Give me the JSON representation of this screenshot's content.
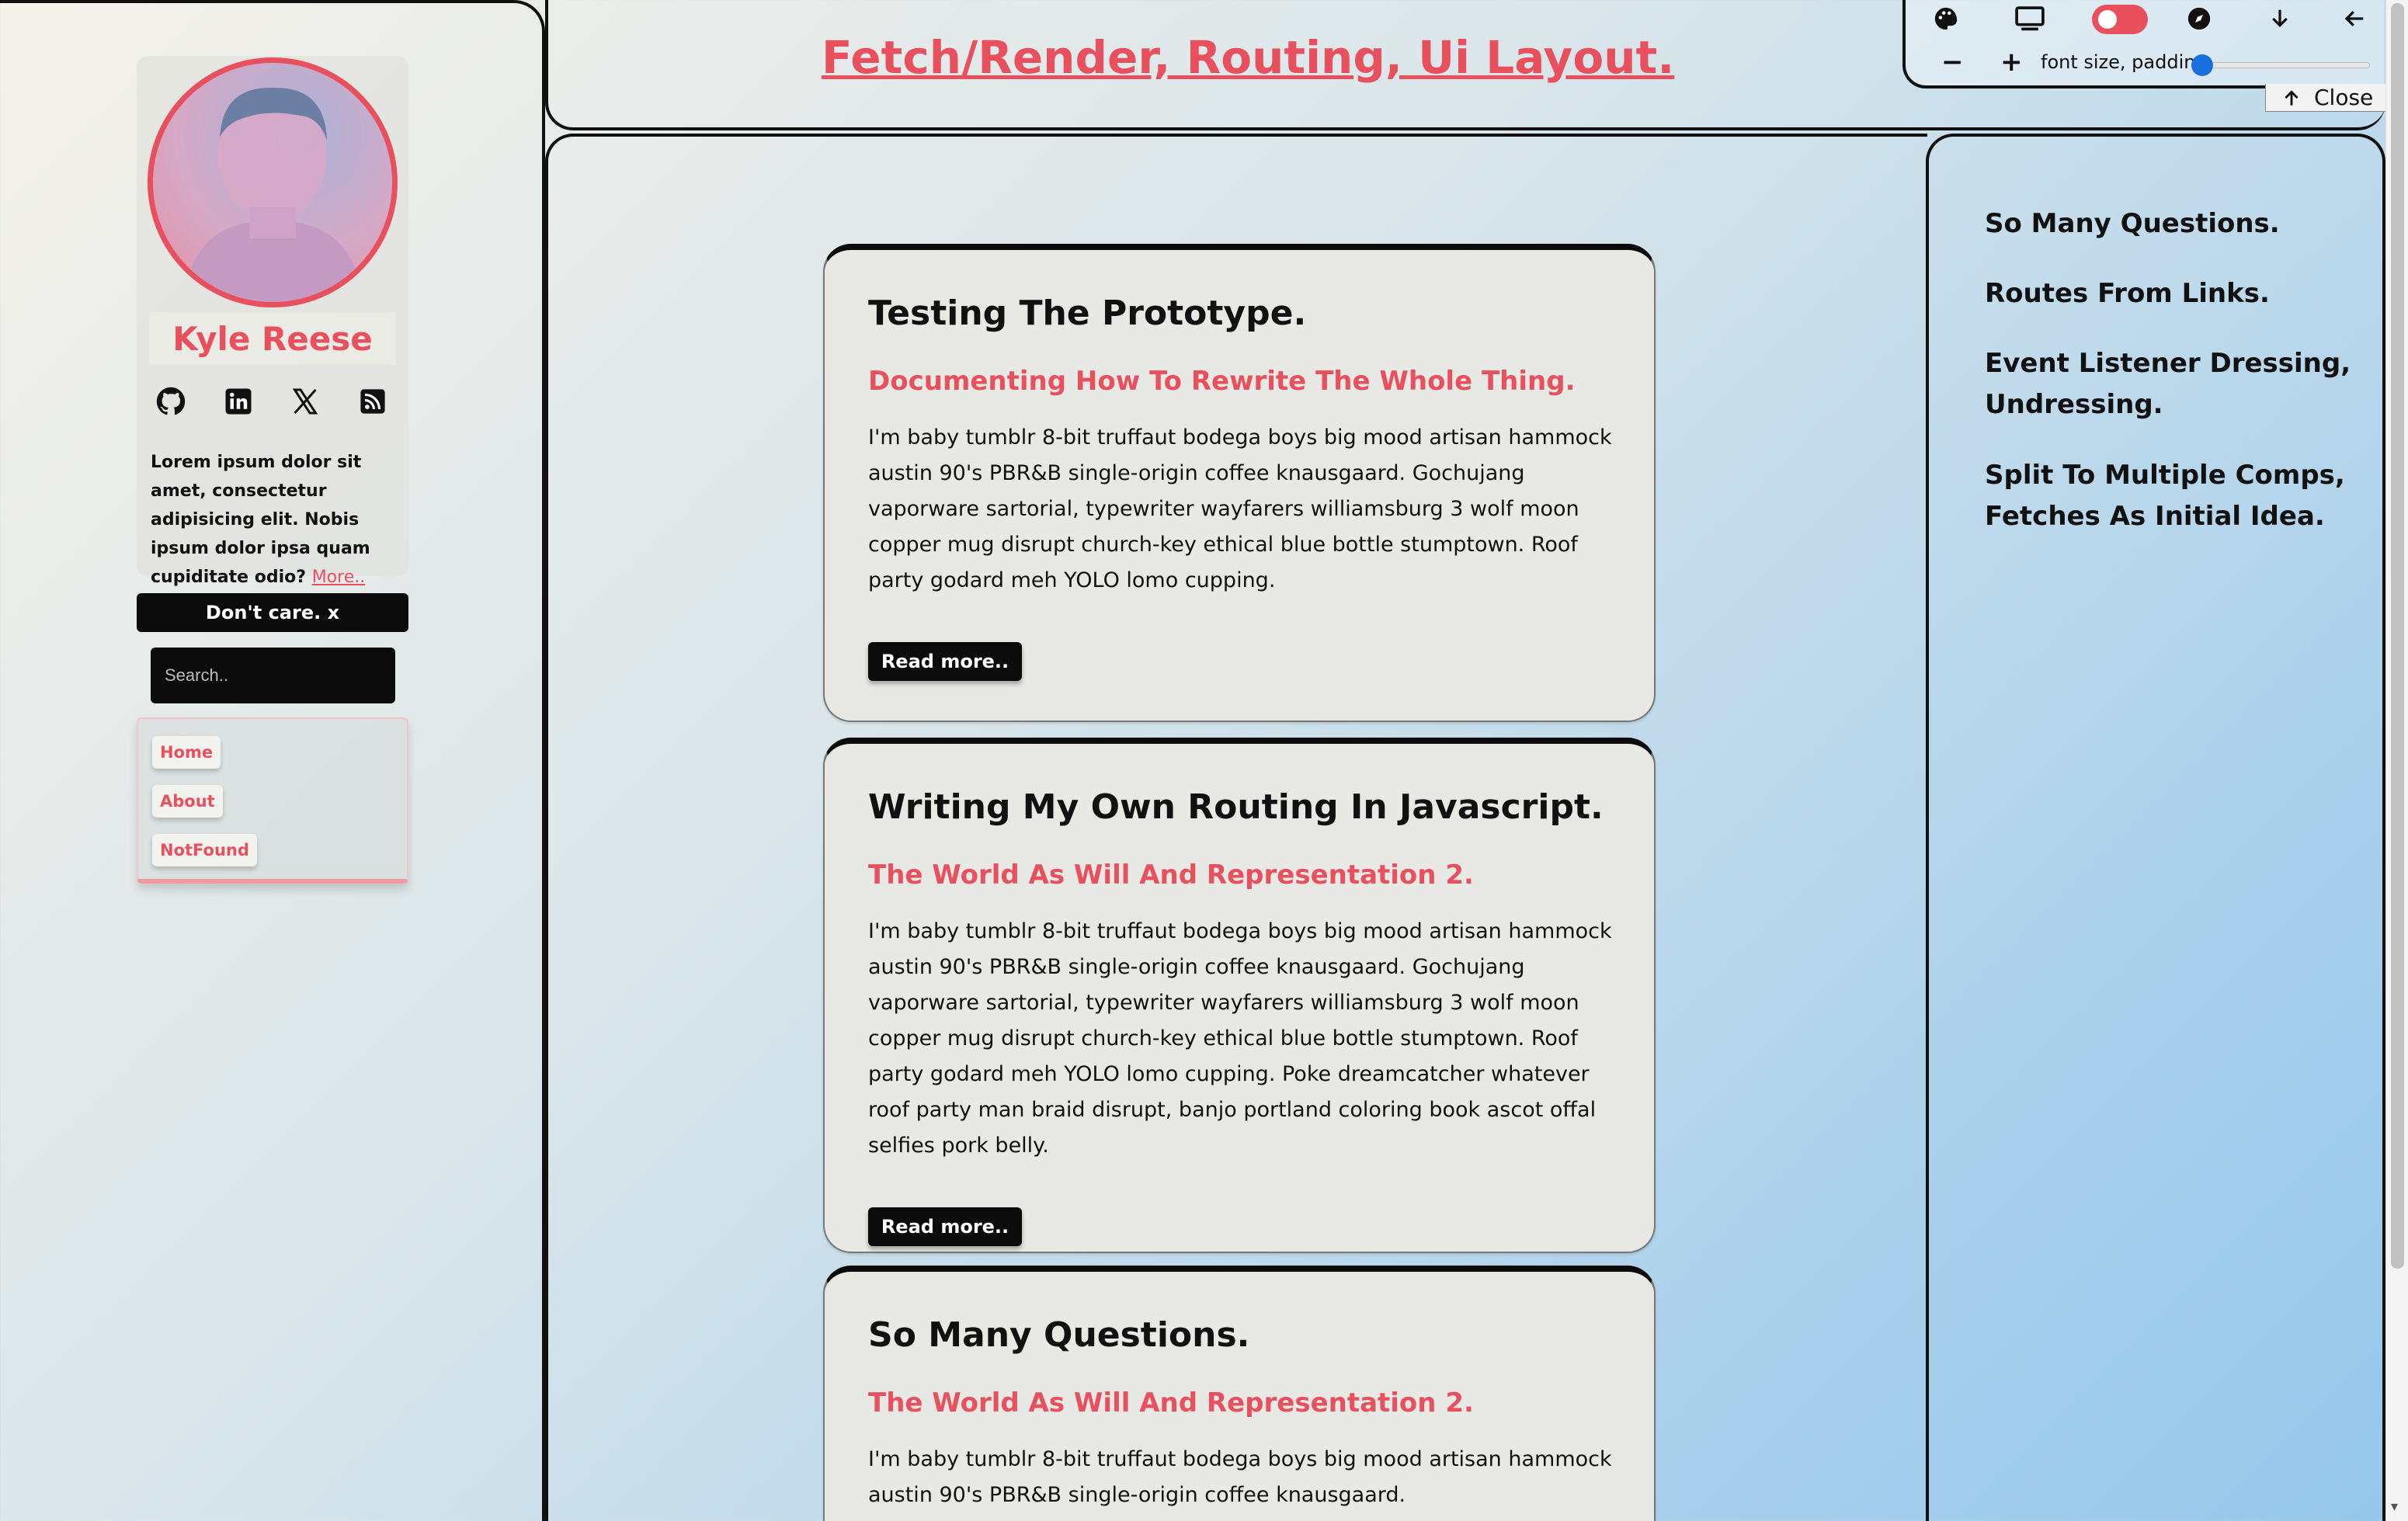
{
  "header": {
    "title": "Fetch/Render, Routing, Ui Layout."
  },
  "toolbar": {
    "icons": [
      "palette-icon",
      "monitor-icon",
      "toggle-switch",
      "compass-icon",
      "arrow-down-icon",
      "arrow-left-icon"
    ],
    "zoom_minus": "−",
    "zoom_plus": "+",
    "slider_label": "font size, padding",
    "slider_value": 0,
    "close_label": "Close",
    "toggle_color": "#e9505e"
  },
  "profile": {
    "name": "Kyle Reese",
    "social": [
      "github-icon",
      "linkedin-icon",
      "x-icon",
      "rss-icon"
    ],
    "bio": "Lorem ipsum dolor sit amet, consectetur adipisicing elit. Nobis ipsum dolor ipsa quam cupiditate odio?",
    "more_link": "More.."
  },
  "dont_care_button": "Don't care. x",
  "search": {
    "placeholder": "Search..",
    "value": ""
  },
  "nav": {
    "items": [
      {
        "label": "Home"
      },
      {
        "label": "About"
      },
      {
        "label": "NotFound"
      }
    ]
  },
  "posts": [
    {
      "title": "Testing The Prototype.",
      "subtitle": "Documenting How To Rewrite The Whole Thing.",
      "body": "I'm baby tumblr 8-bit truffaut bodega boys big mood artisan hammock austin 90's PBR&B single-origin coffee knausgaard. Gochujang vaporware sartorial, typewriter wayfarers williamsburg 3 wolf moon copper mug disrupt church-key ethical blue bottle stumptown. Roof party godard meh YOLO lomo cupping.",
      "button": "Read more.."
    },
    {
      "title": "Writing My Own Routing In Javascript.",
      "subtitle": "The World As Will And Representation 2.",
      "body": "I'm baby tumblr 8-bit truffaut bodega boys big mood artisan hammock austin 90's PBR&B single-origin coffee knausgaard. Gochujang vaporware sartorial, typewriter wayfarers williamsburg 3 wolf moon copper mug disrupt church-key ethical blue bottle stumptown. Roof party godard meh YOLO lomo cupping. Poke dreamcatcher whatever roof party man braid disrupt, banjo portland coloring book ascot offal selfies pork belly.",
      "button": "Read more.."
    },
    {
      "title": "So Many Questions.",
      "subtitle": "The World As Will And Representation 2.",
      "body": "I'm baby tumblr 8-bit truffaut bodega boys big mood artisan hammock austin 90's PBR&B single-origin coffee knausgaard."
    }
  ],
  "toc": {
    "items": [
      "So Many Questions.",
      "Routes From Links.",
      "Event Listener Dressing, Undressing.",
      "Split To Multiple Comps, Fetches As Initial Idea."
    ]
  },
  "colors": {
    "accent": "#e9505e",
    "dark": "#0b0b0b",
    "card": "#e8e9e4"
  }
}
